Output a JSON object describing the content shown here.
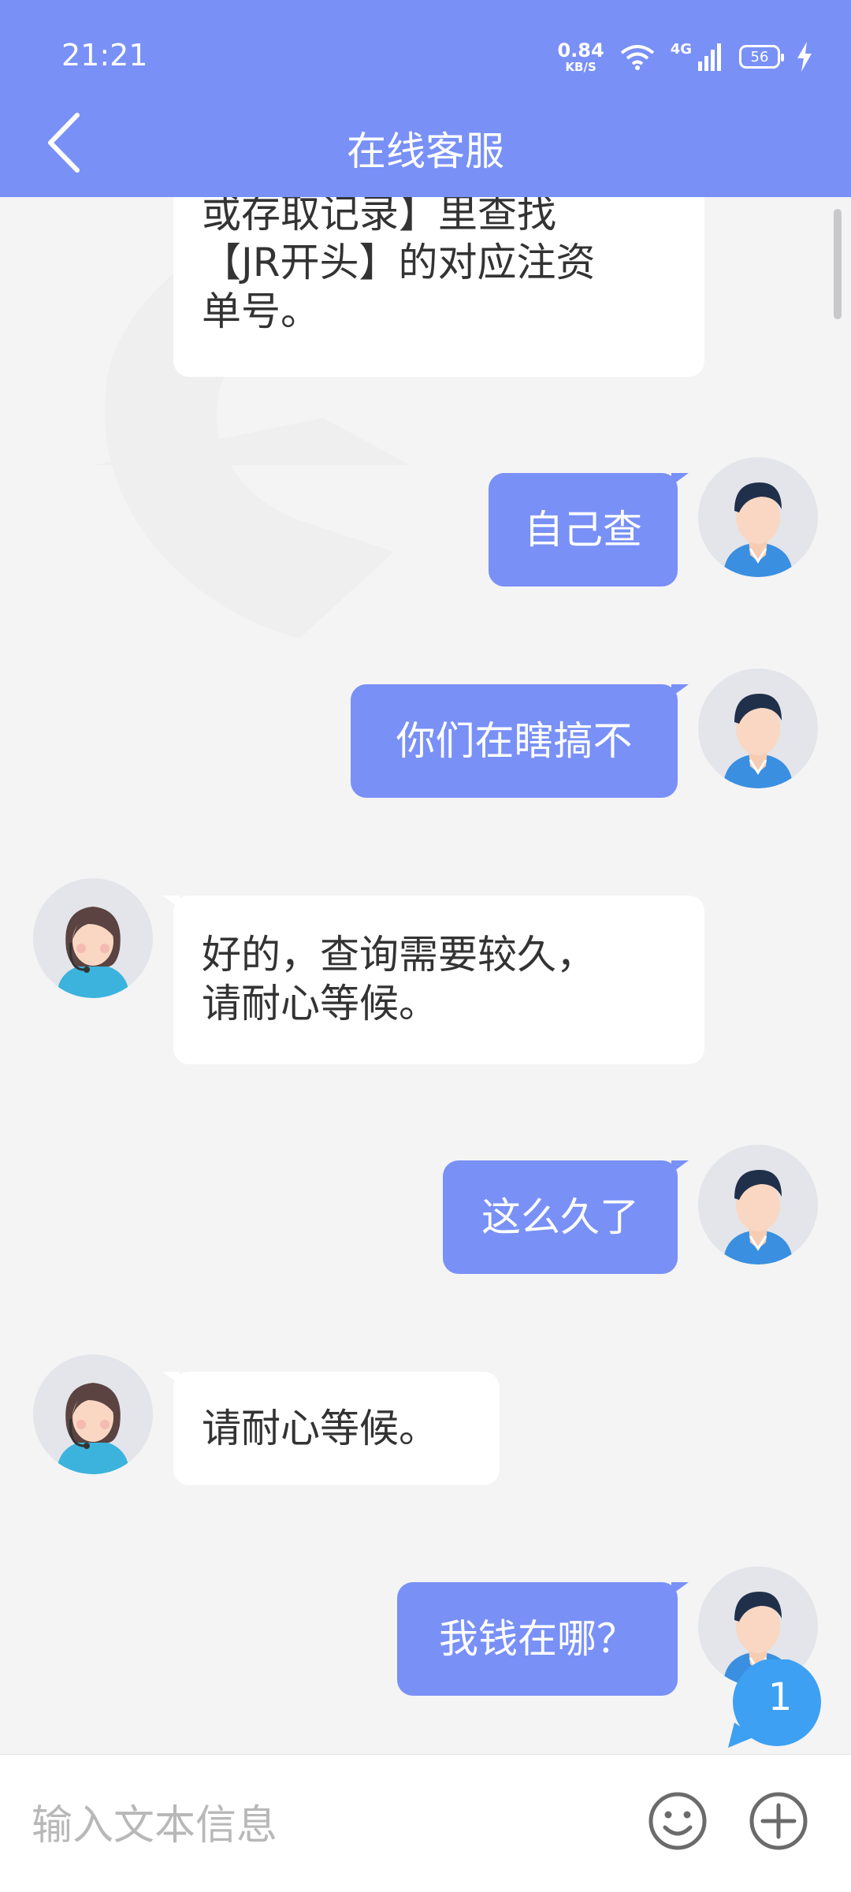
{
  "status": {
    "time": "21:21",
    "speed_value": "0.84",
    "speed_unit": "KB/S",
    "network": "4G",
    "battery": "56"
  },
  "header": {
    "title": "在线客服"
  },
  "messages": [
    {
      "from": "agent",
      "lines": [
        "或存取记录】里查找",
        "【JR开头】的对应注资",
        "单号。"
      ]
    },
    {
      "from": "user",
      "text": "自己查"
    },
    {
      "from": "user",
      "text": "你们在瞎搞不"
    },
    {
      "from": "agent",
      "lines": [
        "好的，查询需要较久，",
        "请耐心等候。"
      ]
    },
    {
      "from": "user",
      "text": "这么久了"
    },
    {
      "from": "agent",
      "lines": [
        "请耐心等候。"
      ]
    },
    {
      "from": "user",
      "text": "我钱在哪？"
    }
  ],
  "input": {
    "placeholder": "输入文本信息"
  },
  "unread_badge": "1",
  "colors": {
    "accent": "#7990f7",
    "background": "#f4f4f5",
    "badge": "#3ea0f3"
  }
}
